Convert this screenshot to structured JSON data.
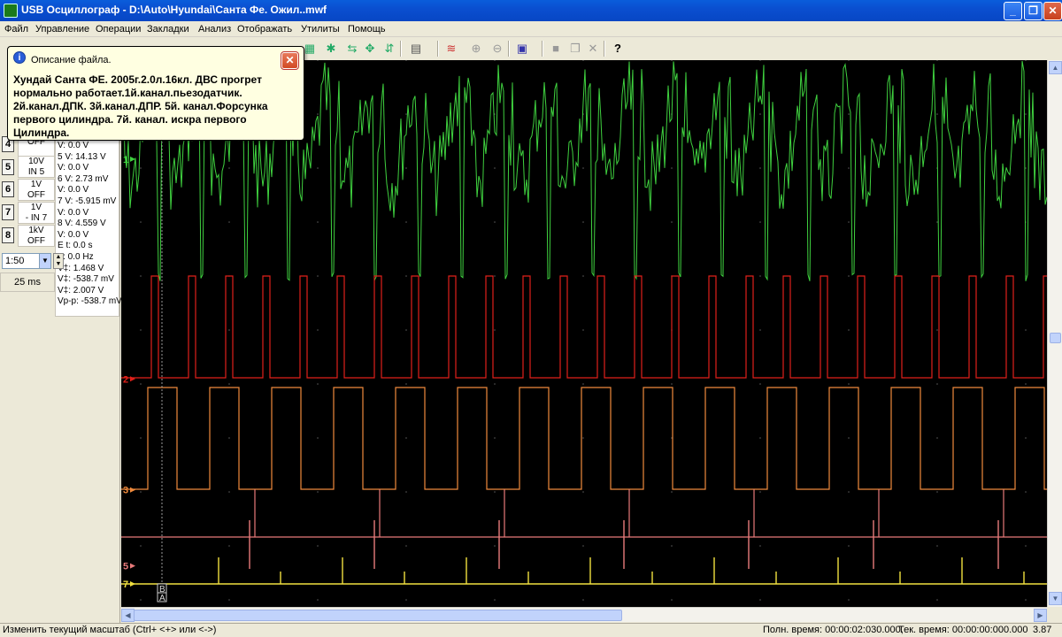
{
  "window": {
    "title": "USB Осциллограф - D:\\Auto\\Hyundai\\Санта Фе. Ожил..mwf",
    "minimize_label": "_",
    "maximize_label": "❐",
    "close_label": "✕"
  },
  "menu": [
    "Файл",
    "Управление",
    "Операции",
    "Закладки",
    "Анализ",
    "Отображать",
    "Утилиты",
    "Помощь"
  ],
  "balloon": {
    "heading": "Описание файла.",
    "text": "Хундай Санта ФЕ. 2005г.2.0л.16кл. ДВС прогрет нормально работает.1й.канал.пьезодатчик. 2й.канал.ДПК. 3й.канал.ДПР. 5й. канал.Форсунка первого цилиндра. 7й. канал. искра первого Цилиндра.",
    "close_label": "✕"
  },
  "channels": [
    {
      "num": "4",
      "line1": "OFF",
      "line2": ""
    },
    {
      "num": "5",
      "line1": "10V",
      "line2": "IN 5"
    },
    {
      "num": "6",
      "line1": "1V",
      "line2": "OFF"
    },
    {
      "num": "7",
      "line1": "1V",
      "line2": "- IN 7"
    },
    {
      "num": "8",
      "line1": "1kV",
      "line2": "OFF"
    }
  ],
  "measurements": [
    "  V: 0.0 V",
    "5  V: 14.13 V",
    "  V: 0.0 V",
    "6  V: 2.73 mV",
    "  V: 0.0 V",
    "7  V: -5.915 mV",
    "  V: 0.0 V",
    "8  V: 4.559 V",
    "  V: 0.0 V",
    "E t: 0.0 s",
    "  F: 0.0 Hz",
    "V‡: 1.468 V",
    "V‡: -538.7 mV",
    "V‡: 2.007 V",
    "Vp-p: -538.7 mV"
  ],
  "zoom": {
    "value": "1:50",
    "dropdown_icon": "▼"
  },
  "time_div": "25 ms",
  "scope": {
    "colors": {
      "ch1": "#3fd13f",
      "ch2": "#e0201a",
      "ch3": "#f08a3c",
      "ch5": "#e87a7a",
      "ch7": "#f0e040",
      "grid": "#5a5a5a"
    },
    "markers": [
      {
        "label": "1",
        "color": "#3fd13f",
        "level": 0.181
      },
      {
        "label": "2",
        "color": "#e0201a",
        "level": 0.583
      },
      {
        "label": "3",
        "color": "#f08a3c",
        "level": 0.786
      },
      {
        "label": "5",
        "color": "#e87a7a",
        "level": 0.925
      },
      {
        "label": "7",
        "color": "#f0e040",
        "level": 0.958
      }
    ],
    "cursor_labels": [
      "B",
      "A"
    ]
  },
  "status": {
    "hint": "Изменить текущий масштаб (Ctrl+ <+> или <->)",
    "full_time": "Полн. время: 00:00:02:030.000,",
    "cur_time": "Тек. время: 00:00:00:000.000",
    "value": "3.87"
  }
}
